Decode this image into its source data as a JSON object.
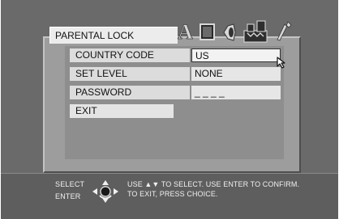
{
  "menu": {
    "title": "PARENTAL LOCK",
    "tab_icons": [
      "language-icon",
      "display-icon",
      "audio-icon",
      "parental-lock-icon",
      "setup-wrench-icon"
    ],
    "rows": [
      {
        "label": "COUNTRY CODE",
        "value": "US",
        "selected": true
      },
      {
        "label": "SET LEVEL",
        "value": "NONE"
      },
      {
        "label": "PASSWORD",
        "value": "_ _ _ _"
      }
    ],
    "exit_label": "EXIT"
  },
  "footer": {
    "select_label": "SELECT",
    "enter_label": "ENTER",
    "hint_line1": "USE ▲▼ TO SELECT.  USE ENTER TO CONFIRM.",
    "hint_line2": "TO EXIT, PRESS CHOICE."
  },
  "colors": {
    "screen_bg": "#6a6a6a",
    "panel_bg": "#9d9d9d",
    "row_bg": "#dcdcdc",
    "footer_bg": "#5e5e5e"
  }
}
